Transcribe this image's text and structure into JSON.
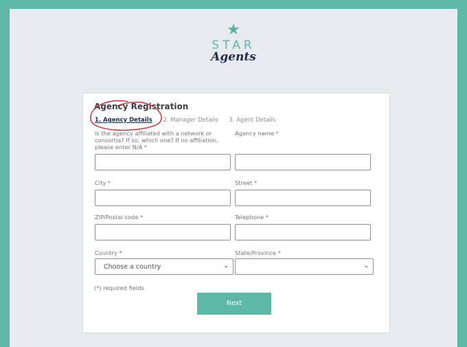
{
  "brand": {
    "star_glyph": "★",
    "line1": "STAR",
    "line2": "Agents",
    "colors": {
      "teal": "#5eb8a8",
      "navy": "#1f2d4e"
    }
  },
  "form": {
    "title": "Agency Registration",
    "steps": [
      "1. Agency Details",
      "2. Manager Details",
      "3. Agent Details"
    ],
    "active_step_index": 0,
    "fields": {
      "network": {
        "label": "Is the agency affiliated with a network or consortia? If so, which one? If no affiliation, please enter N/A *",
        "value": ""
      },
      "agency_name": {
        "label": "Agency name *",
        "value": ""
      },
      "city": {
        "label": "City *",
        "value": ""
      },
      "street": {
        "label": "Street *",
        "value": ""
      },
      "zip": {
        "label": "ZIP/Postal code *",
        "value": ""
      },
      "telephone": {
        "label": "Telephone *",
        "value": ""
      },
      "country": {
        "label": "Country *",
        "selected": "Choose a country"
      },
      "state": {
        "label": "State/Province *",
        "selected": ""
      }
    },
    "required_note": "(*) required fields",
    "next_label": "Next"
  }
}
